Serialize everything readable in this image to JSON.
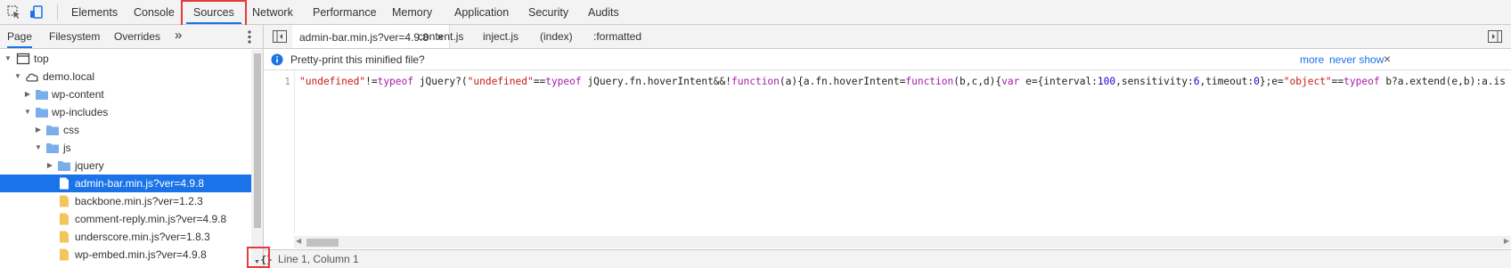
{
  "toolbar": {
    "tabs": [
      {
        "label": "Elements"
      },
      {
        "label": "Console"
      },
      {
        "label": "Sources"
      },
      {
        "label": "Network"
      },
      {
        "label": "Performance"
      },
      {
        "label": "Memory"
      },
      {
        "label": "Application"
      },
      {
        "label": "Security"
      },
      {
        "label": "Audits"
      }
    ],
    "active_tab": "Sources"
  },
  "navigator": {
    "tabs": [
      {
        "label": "Page"
      },
      {
        "label": "Filesystem"
      },
      {
        "label": "Overrides"
      }
    ],
    "more_label": "»",
    "tree": [
      {
        "label": "top",
        "icon": "frame-icon"
      },
      {
        "label": "demo.local",
        "icon": "cloud-icon"
      },
      {
        "label": "wp-content",
        "icon": "folder-icon"
      },
      {
        "label": "wp-includes",
        "icon": "folder-icon"
      },
      {
        "label": "css",
        "icon": "folder-icon"
      },
      {
        "label": "js",
        "icon": "folder-icon"
      },
      {
        "label": "jquery",
        "icon": "folder-icon"
      },
      {
        "label": "admin-bar.min.js?ver=4.9.8",
        "icon": "file-icon"
      },
      {
        "label": "backbone.min.js?ver=1.2.3",
        "icon": "file-icon"
      },
      {
        "label": "comment-reply.min.js?ver=4.9.8",
        "icon": "file-icon"
      },
      {
        "label": "underscore.min.js?ver=1.8.3",
        "icon": "file-icon"
      },
      {
        "label": "wp-embed.min.js?ver=4.9.8",
        "icon": "file-icon"
      }
    ]
  },
  "editor": {
    "file_tabs": [
      {
        "label": "admin-bar.min.js?ver=4.9.8"
      },
      {
        "label": "content.js"
      },
      {
        "label": "inject.js"
      },
      {
        "label": "(index)"
      },
      {
        "label": ":formatted"
      }
    ],
    "close_glyph": "×",
    "infobar": {
      "message": "Pretty-print this minified file?",
      "more": "more",
      "never_show": "never show",
      "close": "×"
    },
    "line_number": "1",
    "status": "Line 1, Column 1",
    "pretty_print_glyph": "{}"
  },
  "colors": {
    "accent": "#1a73e8",
    "highlight_box": "#e5393e",
    "folder": "#7aaee8",
    "file": "#f4c55b"
  }
}
